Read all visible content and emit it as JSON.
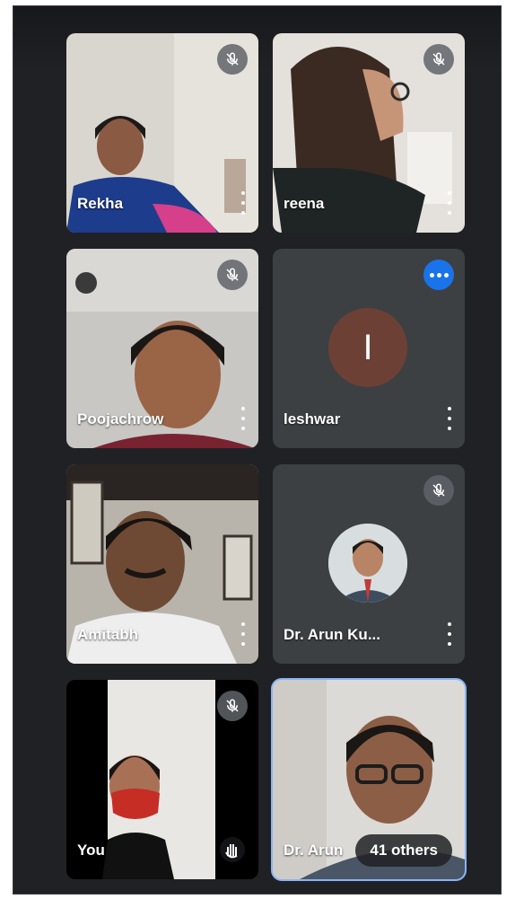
{
  "participants": [
    {
      "name": "Rekha",
      "mic": "mic-off-icon"
    },
    {
      "name": "reena",
      "mic": "mic-off-icon"
    },
    {
      "name": "Poojachrow",
      "mic": "mic-off-icon"
    },
    {
      "name": "leshwar",
      "initial": "I",
      "status": "speaking-indicator-icon"
    },
    {
      "name": "Amitabh",
      "mic": "none"
    },
    {
      "name": "Dr. Arun Ku...",
      "mic": "mic-off-icon"
    },
    {
      "name": "You",
      "mic": "mic-off-icon"
    },
    {
      "name": "Dr. Arun",
      "mic": "none"
    }
  ],
  "others_label": "41 others",
  "colors": {
    "background": "#202124",
    "tile": "#3c4043",
    "active_border": "#8ab4f8",
    "speaking_badge": "#1a73e8",
    "avatar_letter_bg": "#6d4036"
  }
}
